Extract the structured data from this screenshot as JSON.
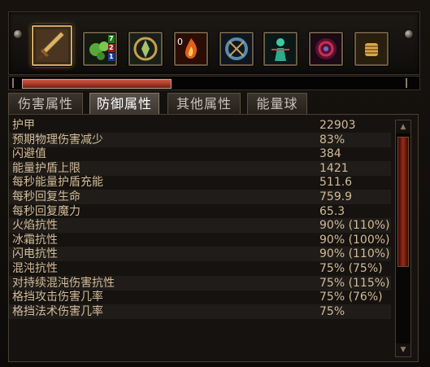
{
  "skills": [
    {
      "name": "sword-skill-icon",
      "selected": true
    },
    {
      "name": "green-orbs-skill-icon",
      "selected": false,
      "badges": [
        "7",
        "2",
        "1"
      ]
    },
    {
      "name": "golden-emblem-skill-icon",
      "selected": false
    },
    {
      "name": "fire-skill-icon",
      "selected": false,
      "overlay": "0"
    },
    {
      "name": "blue-ring-skill-icon",
      "selected": false
    },
    {
      "name": "teal-figure-skill-icon",
      "selected": false
    },
    {
      "name": "red-vortex-skill-icon",
      "selected": false
    },
    {
      "name": "golden-fist-skill-icon",
      "selected": false
    }
  ],
  "progress": {
    "value": 0.36
  },
  "tabs": [
    {
      "label": "伤害属性",
      "active": false
    },
    {
      "label": "防御属性",
      "active": true
    },
    {
      "label": "其他属性",
      "active": false
    },
    {
      "label": "能量球",
      "active": false
    }
  ],
  "stats": [
    {
      "name": "护甲",
      "value": "22903"
    },
    {
      "name": "预期物理伤害减少",
      "value": "83%"
    },
    {
      "name": "闪避值",
      "value": "384"
    },
    {
      "name": "能量护盾上限",
      "value": "1421"
    },
    {
      "name": "每秒能量护盾充能",
      "value": "511.6"
    },
    {
      "name": "每秒回复生命",
      "value": "759.9"
    },
    {
      "name": "每秒回复魔力",
      "value": "65.3"
    },
    {
      "name": "火焰抗性",
      "value": "90% (110%)"
    },
    {
      "name": "冰霜抗性",
      "value": "90% (100%)"
    },
    {
      "name": "闪电抗性",
      "value": "90% (110%)"
    },
    {
      "name": "混沌抗性",
      "value": "75% (75%)"
    },
    {
      "name": "对持续混沌伤害抗性",
      "value": "75% (115%)"
    },
    {
      "name": "格挡攻击伤害几率",
      "value": "75% (76%)"
    },
    {
      "name": "格挡法术伤害几率",
      "value": "75%"
    }
  ],
  "colors": {
    "stat_text": "#d2bb97",
    "tab_active": "#ffffff",
    "progress_fill": "#b03a28",
    "scroll_thumb": "#9a2a16"
  }
}
